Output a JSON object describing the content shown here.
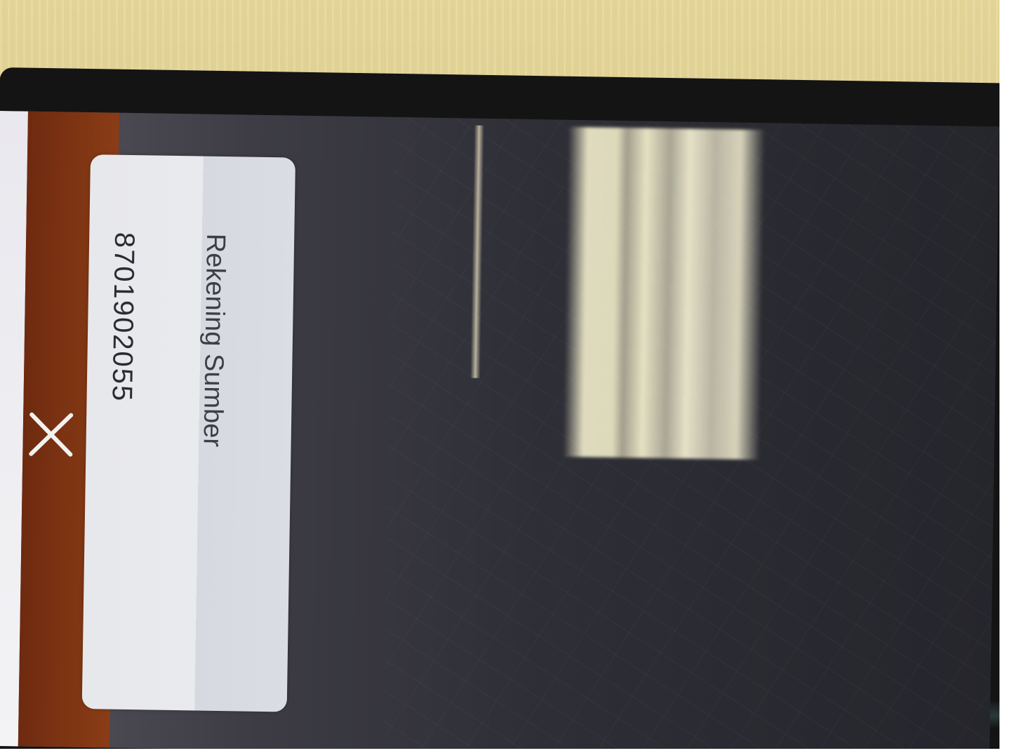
{
  "dialog": {
    "label": "Rekening Sumber",
    "value": "8701902055"
  },
  "header": {
    "close_icon": "close-icon",
    "bar_color": "#7d3412"
  }
}
